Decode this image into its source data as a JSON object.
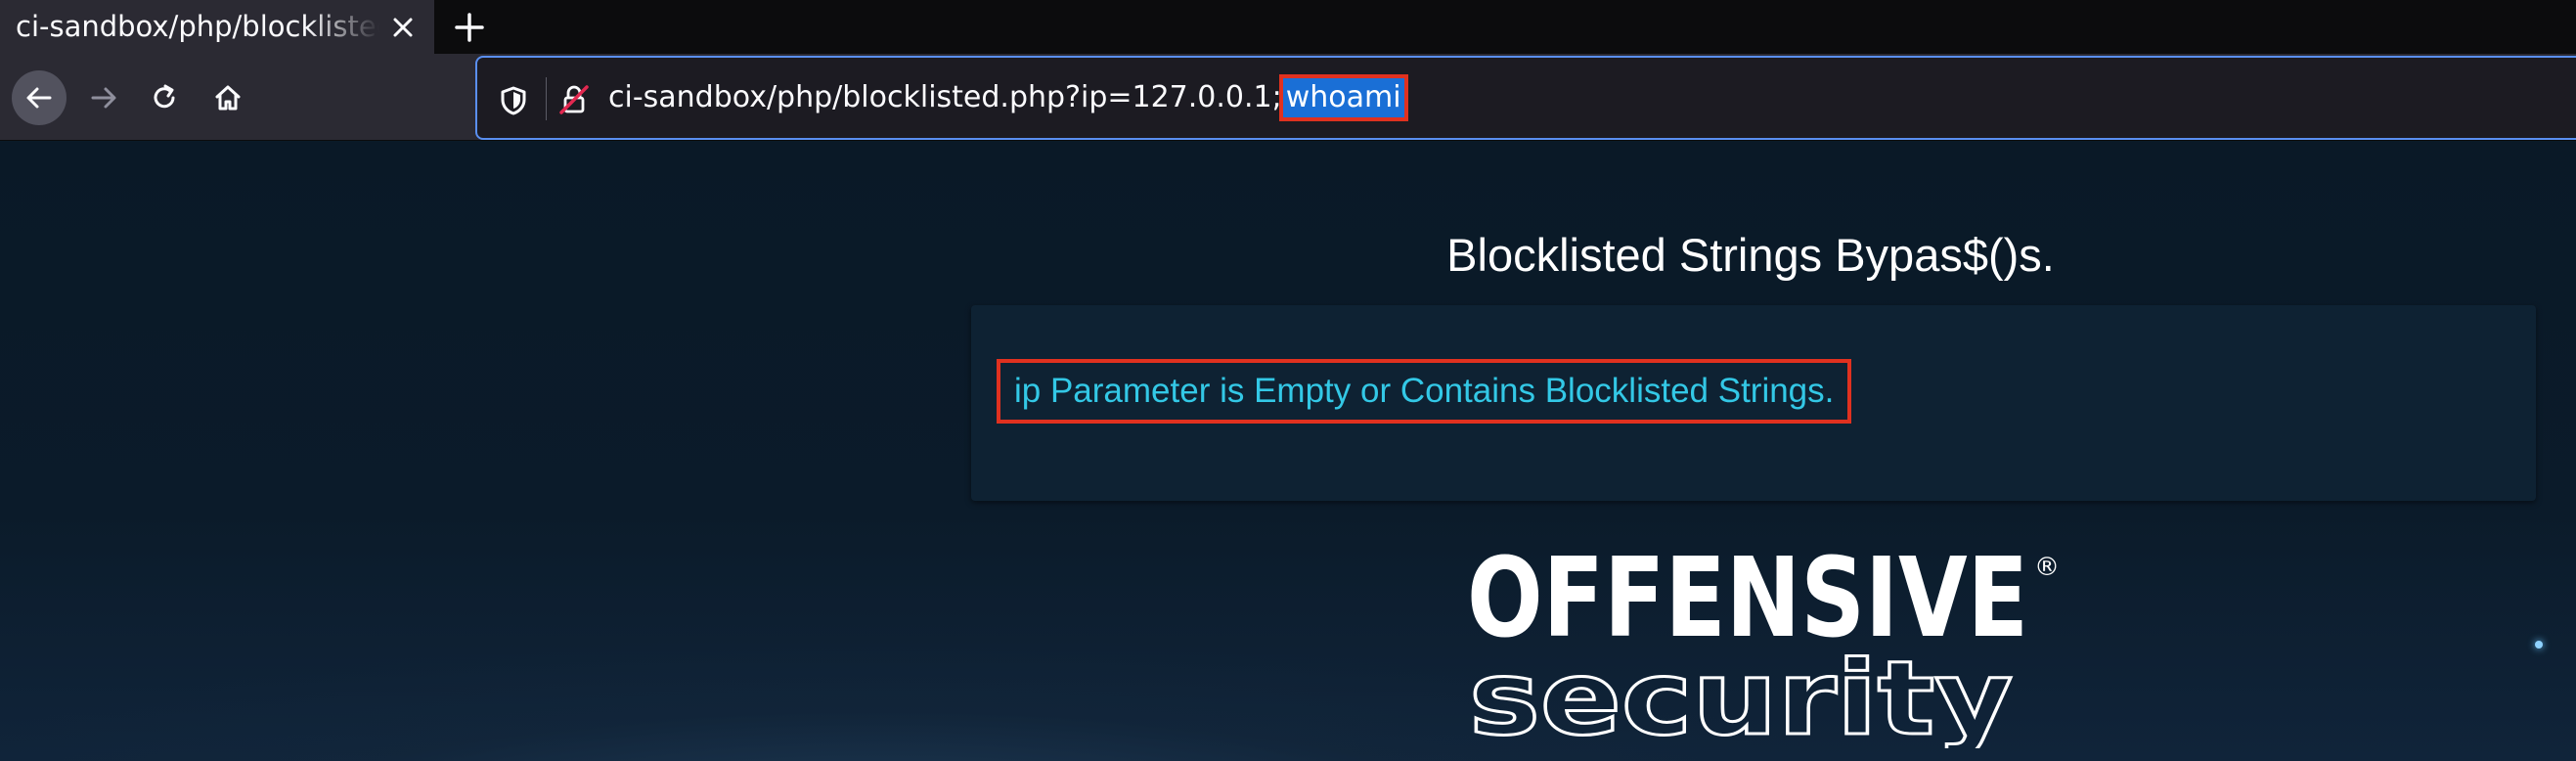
{
  "browser": {
    "tab": {
      "title": "ci-sandbox/php/blocklisted.php"
    },
    "url": {
      "prefix": "ci-sandbox/php/blocklisted.php?ip=127.0.0.1;",
      "highlighted": "whoami"
    }
  },
  "page": {
    "heading": "Blocklisted Strings Bypas$()s.",
    "message": "ip Parameter is Empty or Contains Blocklisted Strings.",
    "logo": {
      "line1": "OFFENSIVE",
      "line2": "security",
      "mark": "®"
    }
  },
  "colors": {
    "accent_blue": "#5a8ff0",
    "selection": "#1a6fd6",
    "annotation_red": "#e0311f",
    "message_cyan": "#33c8e6"
  },
  "icons": [
    "close-icon",
    "plus-icon",
    "arrow-left-icon",
    "arrow-right-icon",
    "reload-icon",
    "home-icon",
    "shield-icon",
    "insecure-lock-icon"
  ]
}
